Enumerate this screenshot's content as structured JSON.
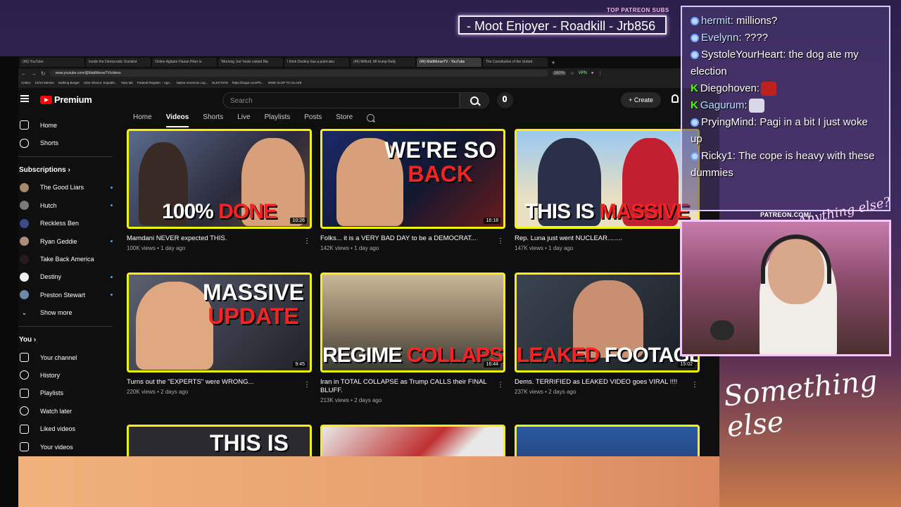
{
  "overlay": {
    "patreon_label": "TOP PATREON SUBS",
    "patreon_names": "- Moot Enjoyer - Roadkill - Jrb856",
    "patreon_url": "PATREON.COM/",
    "signature_top": "Anything else?",
    "signature_bottom": "Something else"
  },
  "browser": {
    "tabs": [
      {
        "label": "(46) YouTube"
      },
      {
        "label": "Inside the Democratic Socialist"
      },
      {
        "label": "Online Agitator Hasan Piker is"
      },
      {
        "label": "'Morning Joe' hosts visited Ma"
      },
      {
        "label": "I think Destiny has a point abo"
      },
      {
        "label": "(46) Milford, MI trump Rally"
      },
      {
        "label": "(46) MattMorseTV - YouTube"
      },
      {
        "label": "The Constitution of the United"
      }
    ],
    "url": "www.youtube.com/@MattMorseTV/videos",
    "zoom": "160%",
    "vpn": "VPN",
    "bookmarks": [
      "Celtics",
      "10/10 Memes",
      "Nothing Burger",
      "Clair Obscur: Expediti...",
      "New tab",
      "Federal Register :: Age...",
      "Native American Lay...",
      "ELECTION",
      "https://imgur.com/P5...",
      "WWE SLOP TO GLAZE"
    ]
  },
  "youtube": {
    "brand": "Premium",
    "search_placeholder": "Search",
    "create_label": "+ Create",
    "sidebar": {
      "main": [
        {
          "label": "Home"
        },
        {
          "label": "Shorts"
        }
      ],
      "subscriptions_title": "Subscriptions",
      "subscriptions": [
        {
          "label": "The Good Liars"
        },
        {
          "label": "Hutch"
        },
        {
          "label": "Reckless Ben"
        },
        {
          "label": "Ryan Geddie"
        },
        {
          "label": "Take Back America"
        },
        {
          "label": "Destiny"
        },
        {
          "label": "Preston Stewart"
        }
      ],
      "show_more": "Show more",
      "you_title": "You",
      "you_items": [
        {
          "label": "Your channel"
        },
        {
          "label": "History"
        },
        {
          "label": "Playlists"
        },
        {
          "label": "Watch later"
        },
        {
          "label": "Liked videos"
        },
        {
          "label": "Your videos"
        }
      ]
    },
    "channel_tabs": [
      "Home",
      "Videos",
      "Shorts",
      "Live",
      "Playlists",
      "Posts",
      "Store"
    ],
    "videos": [
      {
        "title": "Mamdani NEVER expected THIS.",
        "views": "100K views",
        "age": "1 day ago",
        "duration": "10:26",
        "thumb_text": "100%",
        "thumb_red": "DONE"
      },
      {
        "title": "Folks... it is a VERY BAD DAY to be a DEMOCRAT...",
        "views": "142K views",
        "age": "1 day ago",
        "duration": "16:18",
        "thumb_text": "WE'RE SO",
        "thumb_red": "BACK"
      },
      {
        "title": "Rep. Luna just went NUCLEAR........",
        "views": "147K views",
        "age": "1 day ago",
        "duration": "",
        "thumb_text": "THIS IS",
        "thumb_red": "MASSIVE"
      },
      {
        "title": "Turns out the \"EXPERTS\" were WRONG...",
        "views": "220K views",
        "age": "2 days ago",
        "duration": "9:45",
        "thumb_text": "MASSIVE",
        "thumb_red": "UPDATE"
      },
      {
        "title": "Iran in TOTAL COLLAPSE as Trump CALLS their FINAL BLUFF.",
        "views": "213K views",
        "age": "2 days ago",
        "duration": "16:44",
        "thumb_text": "REGIME",
        "thumb_red": "COLLAPSE"
      },
      {
        "title": "Dems. TERRIFIED as LEAKED VIDEO goes VIRAL !!!!",
        "views": "237K views",
        "age": "2 days ago",
        "duration": "15:02",
        "thumb_text": "FOOTAGE",
        "thumb_red": "LEAKED"
      },
      {
        "title": "",
        "views": "",
        "age": "",
        "duration": "",
        "thumb_text": "THIS IS",
        "thumb_red": ""
      }
    ]
  },
  "chat": [
    {
      "user": "hermit",
      "msg": " millions?",
      "badge": "blue"
    },
    {
      "user": "Evelynn",
      "msg": " ????",
      "badge": "blue"
    },
    {
      "user": "SystoleYourHeart",
      "msg": " the dog ate my election",
      "badge": "blue"
    },
    {
      "user": "Diegohoven",
      "msg": "",
      "badge": "kick"
    },
    {
      "user": "Gagurum",
      "msg": "",
      "badge": "kick"
    },
    {
      "user": "PryingMind",
      "msg": " Pagi in a bit I just woke up",
      "badge": "blue"
    },
    {
      "user": "Ricky1",
      "msg": " The cope is heavy with these dummies",
      "badge": "blue"
    }
  ]
}
